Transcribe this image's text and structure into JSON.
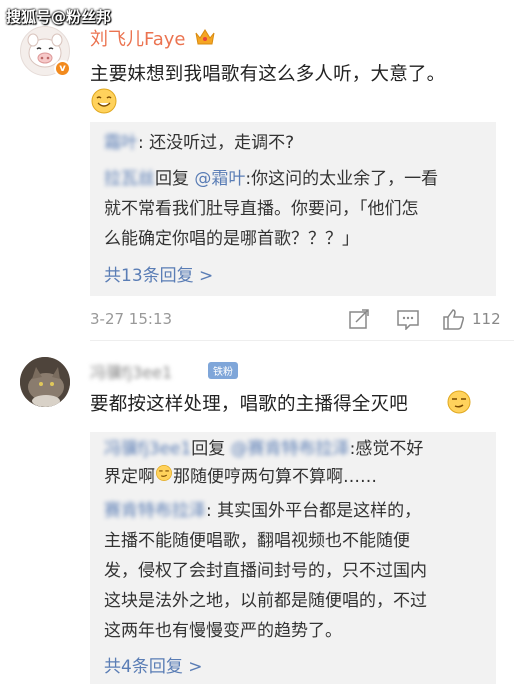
{
  "watermark": "搜狐号@粉丝邦",
  "comment1": {
    "username": "刘飞儿Faye",
    "verified_badge": "v",
    "text": "主要妹想到我唱歌有这么多人听，大意了。",
    "emoji_icon": "laughing-face-icon",
    "replies": [
      {
        "nick": "霜叶",
        "text": ": 还没听过，走调不?"
      },
      {
        "nick": "拉瓦丝",
        "action": "回复",
        "mention": "@霜叶",
        "text_line1": ":你这问的太业余了，一看",
        "text_line2": "就不常看我们肚导直播。你要问，「他们怎",
        "text_line3": "么能确定你唱的是哪首歌？？？」"
      }
    ],
    "more_replies": "共13条回复 >",
    "date": "3-27 15:13",
    "like_count": "112"
  },
  "comment2": {
    "username": "冯骥fj3ee1",
    "fan_badge": "铁粉",
    "text": "要都按这样处理，唱歌的主播得全灭吧",
    "emoji_icon": "smirk-face-icon",
    "replies": [
      {
        "nick": "冯骥fj3ee1",
        "action": "回复",
        "mention": "@赛肯特布拉泽",
        "text_line1": ":感觉不好",
        "text_line2": "界定啊",
        "text_line2b": "那随便哼两句算不算啊……"
      },
      {
        "nick": "赛肯特布拉泽",
        "text_line1": ": 其实国外平台都是这样的，",
        "text_line2": "主播不能随便唱歌，翻唱视频也不能随便",
        "text_line3": "发，侵权了会封直播间封号的，只不过国内",
        "text_line4": "这块是法外之地，以前都是随便唱的，不过",
        "text_line5": "这两年也有慢慢变严的趋势了。"
      }
    ],
    "more_replies": "共4条回复 >"
  },
  "colors": {
    "username": "#eb7350",
    "link": "#5a7db5",
    "reply_bg": "#f2f2f2",
    "meta": "#999999"
  }
}
